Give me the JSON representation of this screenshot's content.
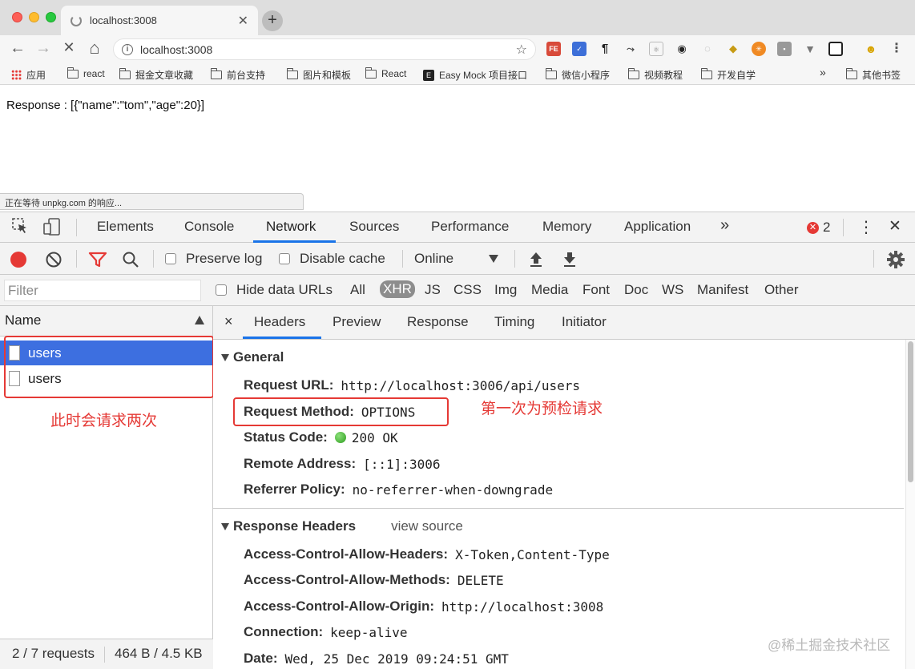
{
  "browser": {
    "tab_title": "localhost:3008",
    "tab_close": "✕",
    "new_tab": "+",
    "back": "←",
    "forward": "→",
    "stop": "✕",
    "home": "⌂",
    "address": "localhost:3008",
    "bookmark_star": "☆",
    "bookmarks": [
      "应用",
      "react",
      "掘金文章收藏",
      "前台支持",
      "图片和模板",
      "React",
      "Easy Mock 项目接口",
      "微信小程序",
      "视频教程",
      "开发自学"
    ],
    "bookmarks_more": "»",
    "other_bookmarks": "其他书签"
  },
  "page": {
    "response_text": "Response : [{\"name\":\"tom\",\"age\":20}]",
    "status_bar": "正在等待 unpkg.com 的响应..."
  },
  "devtools": {
    "tabs": [
      "Elements",
      "Console",
      "Network",
      "Sources",
      "Performance",
      "Memory",
      "Application"
    ],
    "tabs_more": "»",
    "error_count": "2",
    "kebab": "⋮",
    "close": "✕",
    "network_toolbar": {
      "preserve_log": "Preserve log",
      "disable_cache": "Disable cache",
      "throttle": "Online"
    },
    "filter": {
      "placeholder": "Filter",
      "hide_data_urls": "Hide data URLs",
      "types": [
        "All",
        "XHR",
        "JS",
        "CSS",
        "Img",
        "Media",
        "Font",
        "Doc",
        "WS",
        "Manifest",
        "Other"
      ]
    },
    "requests": {
      "column_name": "Name",
      "rows": [
        "users",
        "users"
      ],
      "annotation": "此时会请求两次"
    },
    "summary": {
      "requests": "2 / 7 requests",
      "size": "464 B / 4.5 KB"
    },
    "detail": {
      "close": "×",
      "tabs": [
        "Headers",
        "Preview",
        "Response",
        "Timing",
        "Initiator"
      ],
      "general_title": "General",
      "general": {
        "request_url_key": "Request URL:",
        "request_url": "http://localhost:3006/api/users",
        "method_key": "Request Method:",
        "method": "OPTIONS",
        "status_key": "Status Code:",
        "status": "200 OK",
        "remote_key": "Remote Address:",
        "remote": "[::1]:3006",
        "referrer_key": "Referrer Policy:",
        "referrer": "no-referrer-when-downgrade"
      },
      "method_annotation": "第一次为预检请求",
      "response_headers_title": "Response Headers",
      "view_source": "view source",
      "response_headers": [
        {
          "key": "Access-Control-Allow-Headers:",
          "value": "X-Token,Content-Type"
        },
        {
          "key": "Access-Control-Allow-Methods:",
          "value": "DELETE"
        },
        {
          "key": "Access-Control-Allow-Origin:",
          "value": "http://localhost:3008"
        },
        {
          "key": "Connection:",
          "value": "keep-alive"
        },
        {
          "key": "Date:",
          "value": "Wed, 25 Dec 2019 09:24:51 GMT"
        }
      ]
    }
  },
  "watermark": "@稀土掘金技术社区"
}
